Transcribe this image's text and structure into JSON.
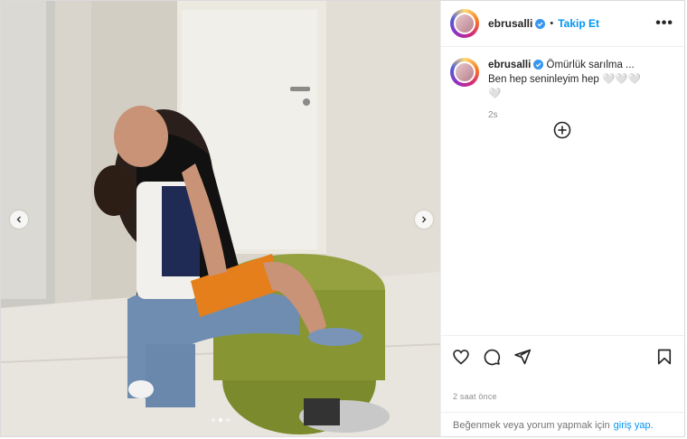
{
  "account": {
    "username": "ebrusalli",
    "separator": "•",
    "follow_label": "Takip Et",
    "more_label": "•••"
  },
  "caption": {
    "username": "ebrusalli",
    "text": "Ömürlük sarılma ... Ben hep seninleyim hep 🤍🤍🤍🤍",
    "time": "2s"
  },
  "post": {
    "time_label": "2 saat önce",
    "carousel_total": 3,
    "carousel_active": 2
  },
  "login_prompt": {
    "text": "Beğenmek veya yorum yapmak için",
    "link": "giriş yap."
  },
  "colors": {
    "accent": "#0095f6",
    "verified": "#3897f0",
    "muted": "#8e8e8e"
  },
  "icons": [
    "heart-icon",
    "comment-icon",
    "share-icon",
    "bookmark-icon",
    "add-icon",
    "verified-icon",
    "chevron-left-icon",
    "chevron-right-icon"
  ]
}
